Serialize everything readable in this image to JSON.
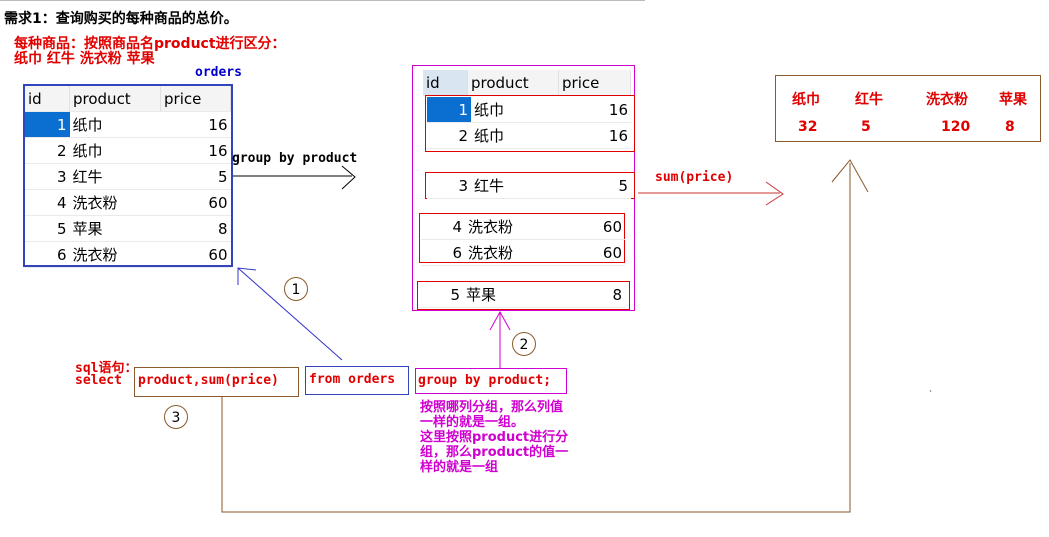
{
  "title": "需求1：查询购买的每种商品的总价。",
  "desc_line1": "每种商品：按照商品名product进行区分：",
  "desc_line2": "纸巾  红牛 洗衣粉 苹果",
  "orders_label": "orders",
  "headers": {
    "id": "id",
    "product": "product",
    "price": "price"
  },
  "orders_rows": [
    {
      "id": "1",
      "product": "纸巾",
      "price": "16"
    },
    {
      "id": "2",
      "product": "纸巾",
      "price": "16"
    },
    {
      "id": "3",
      "product": "红牛",
      "price": "5"
    },
    {
      "id": "4",
      "product": "洗衣粉",
      "price": "60"
    },
    {
      "id": "5",
      "product": "苹果",
      "price": "8"
    },
    {
      "id": "6",
      "product": "洗衣粉",
      "price": "60"
    }
  ],
  "group_by_label": "group by product",
  "grouped": {
    "g1": [
      {
        "id": "1",
        "product": "纸巾",
        "price": "16"
      },
      {
        "id": "2",
        "product": "纸巾",
        "price": "16"
      }
    ],
    "g2": [
      {
        "id": "3",
        "product": "红牛",
        "price": "5"
      }
    ],
    "g3": [
      {
        "id": "4",
        "product": "洗衣粉",
        "price": "60"
      },
      {
        "id": "6",
        "product": "洗衣粉",
        "price": "60"
      }
    ],
    "g4": [
      {
        "id": "5",
        "product": "苹果",
        "price": "8"
      }
    ]
  },
  "sum_label": "sum(price)",
  "result": {
    "names": [
      "纸巾",
      "红牛",
      "洗衣粉",
      "苹果"
    ],
    "totals": [
      "32",
      "5",
      "120",
      "8"
    ]
  },
  "sql_heading": "sql语句：",
  "sql": {
    "select": "select",
    "part1": "product,sum(price)",
    "part2": "from orders",
    "part3": "group by product;"
  },
  "note_lines": [
    "按照哪列分组，那么列值",
    "一样的就是一组。",
    "这里按照product进行分",
    "组，那么product的值一",
    "样的就是一组"
  ],
  "markers": [
    "1",
    "2",
    "3"
  ],
  "colors": {
    "red": "#e00000",
    "blue": "#0000cc",
    "magenta": "#d000d0",
    "brown": "#8a5a2a"
  }
}
